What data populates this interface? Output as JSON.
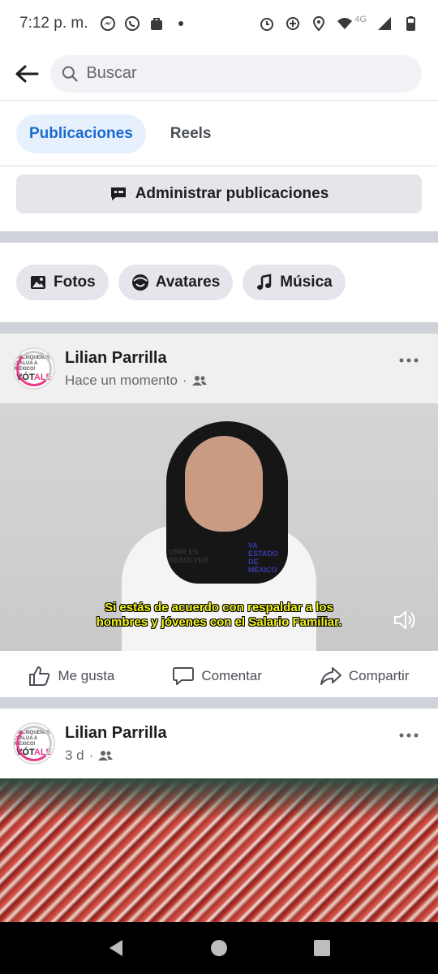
{
  "status_bar": {
    "time": "7:12 p. m.",
    "network": "4G"
  },
  "search": {
    "placeholder": "Buscar"
  },
  "tabs": [
    {
      "label": "Publicaciones",
      "active": true
    },
    {
      "label": "Reels",
      "active": false
    }
  ],
  "manage": {
    "label": "Administrar publicaciones"
  },
  "chips": [
    {
      "label": "Fotos",
      "icon": "photos-icon"
    },
    {
      "label": "Avatares",
      "icon": "avatar-icon"
    },
    {
      "label": "Música",
      "icon": "music-note-icon"
    }
  ],
  "posts": [
    {
      "author": "Lilian Parrilla",
      "time": "Hace un momento",
      "audience": "friends-icon",
      "avatar_text": {
        "line1": "MEXIQUENSE",
        "line2": "¡SALUA A MÉXICO!",
        "line3": "VÓT",
        "line3_accent": "ALE"
      },
      "video_subtitle_line1": "Si estás de acuerdo con respaldar a los",
      "video_subtitle_line2": "hombres y jóvenes con el Salario Familiar.",
      "shirt_text_left": "UNIR ES RESOLVER",
      "shirt_text_right": "VA ESTADO DE MÉXICO"
    },
    {
      "author": "Lilian Parrilla",
      "time": "3 d",
      "audience": "friends-icon",
      "avatar_text": {
        "line1": "MEXIQUENSE",
        "line2": "¡SALUA A MÉXICO!",
        "line3": "VÓT",
        "line3_accent": "ALE"
      }
    }
  ],
  "actions": {
    "like": "Me gusta",
    "comment": "Comentar",
    "share": "Compartir"
  },
  "colors": {
    "accent": "#1b6ad0",
    "tab_active_bg": "#e7f0fd",
    "separator": "#cfd2d8",
    "subtitle": "#f5f51e"
  }
}
